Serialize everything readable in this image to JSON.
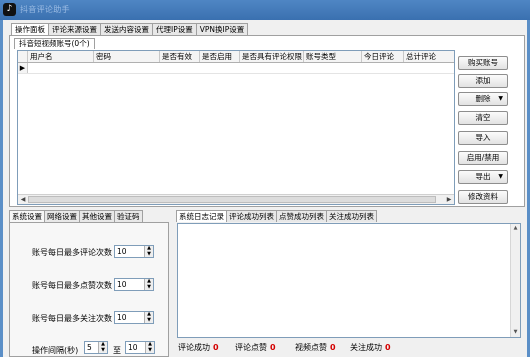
{
  "window": {
    "title": "抖音评论助手",
    "icon": "tiktok-icon"
  },
  "main_tabs": [
    "操作面板",
    "评论来源设置",
    "发送内容设置",
    "代理IP设置",
    "VPN换IP设置"
  ],
  "account_panel": {
    "tab_label": "抖音短视频账号(0个)",
    "columns": [
      "用户名",
      "密码",
      "是否有效",
      "是否启用",
      "是否具有评论权限",
      "账号类型",
      "今日评论",
      "总计评论"
    ],
    "row_indicator": "▶",
    "buttons": {
      "buy": "购买账号",
      "add": "添加",
      "delete": "删除",
      "clear": "清空",
      "import": "导入",
      "enable_disable": "启用/禁用",
      "export": "导出",
      "modify": "修改资料"
    }
  },
  "settings": {
    "tabs": [
      "系统设置",
      "网络设置",
      "其他设置",
      "验证码"
    ],
    "max_comments_label": "账号每日最多评论次数",
    "max_comments_value": "10",
    "max_likes_label": "账号每日最多点赞次数",
    "max_likes_value": "10",
    "max_follows_label": "账号每日最多关注次数",
    "max_follows_value": "10",
    "interval_label": "操作间隔(秒)",
    "interval_from": "5",
    "interval_to_label": "至",
    "interval_to": "10"
  },
  "log": {
    "tabs": [
      "系统日志记录",
      "评论成功列表",
      "点赞成功列表",
      "关注成功列表"
    ],
    "stats": {
      "comment_label": "评论成功",
      "comment_value": "0",
      "like_label": "评论点赞",
      "like_value": "0",
      "video_like_label": "视频点赞",
      "video_like_value": "0",
      "follow_label": "关注成功",
      "follow_value": "0"
    }
  },
  "colors": {
    "stat_number": "#d40000",
    "title_bar": "#4f86c4"
  }
}
